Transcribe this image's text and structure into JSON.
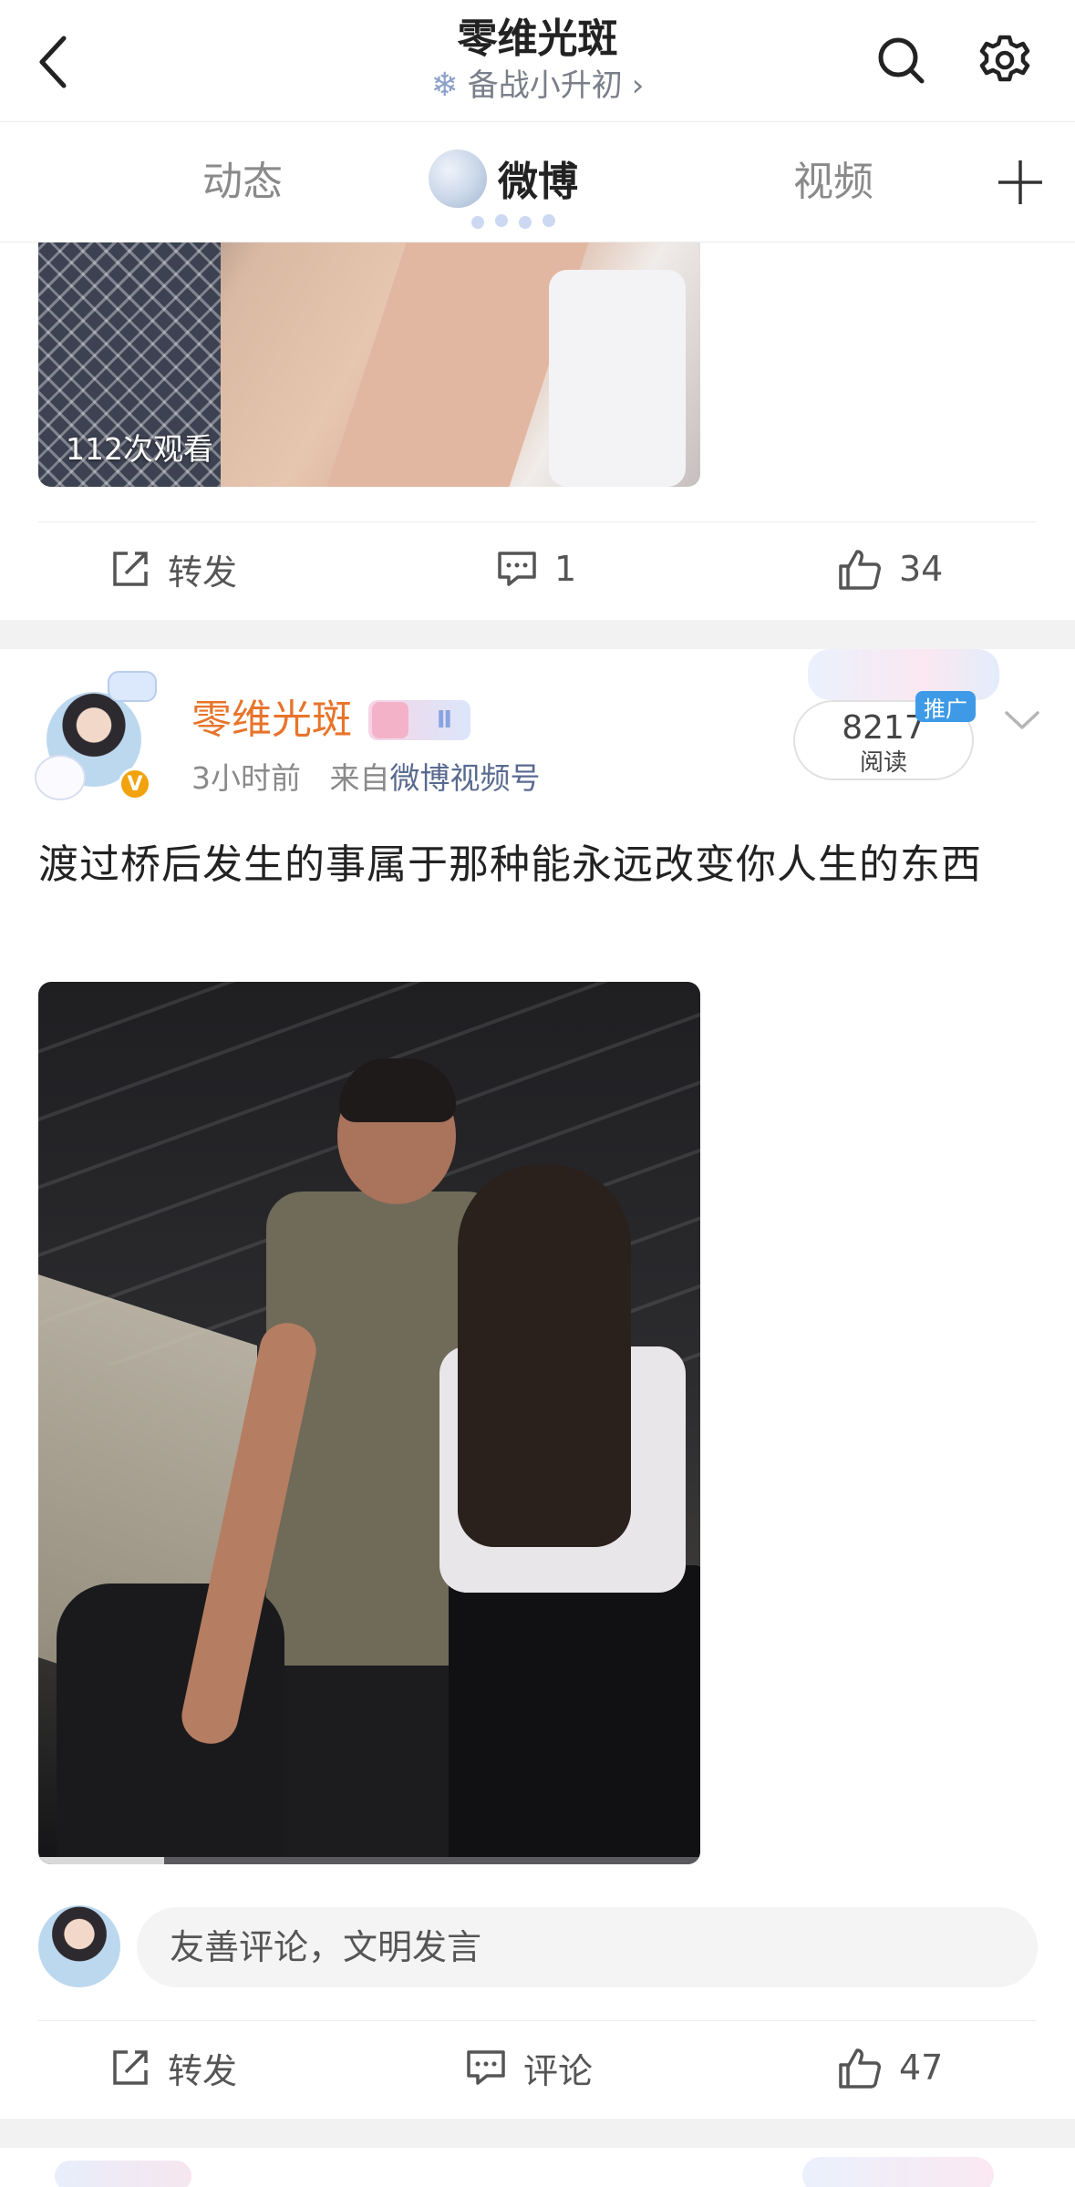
{
  "header": {
    "title": "零维光斑",
    "subtitle": "备战小升初",
    "subtitle_chevron": "›",
    "icons": [
      "back-icon",
      "search-icon",
      "gear-icon"
    ]
  },
  "tabs": {
    "items": [
      {
        "label": "动态",
        "active": false
      },
      {
        "label": "微博",
        "active": true
      },
      {
        "label": "视频",
        "active": false
      }
    ],
    "add_icon": "plus-icon"
  },
  "post1": {
    "view_count": "112次观看",
    "actions": {
      "repost_label": "转发",
      "comment_count": "1",
      "like_count": "34"
    }
  },
  "post2": {
    "username": "零维光斑",
    "badge_text": "Ⅱ",
    "verified_badge": "V",
    "time": "3小时前",
    "source_prefix": "来自",
    "source": "微博视频号",
    "promo": {
      "count": "8217",
      "label": "阅读",
      "tag": "推广"
    },
    "text": "渡过桥后发生的事属于那种能永远改变你人生的东西",
    "video_progress": 0.19,
    "comment_placeholder": "友善评论，文明发言",
    "actions": {
      "repost_label": "转发",
      "comment_label": "评论",
      "like_count": "47"
    }
  },
  "colors": {
    "username": "#e8742b",
    "source_link": "#596a8f",
    "promo_tag": "#3e9ae6",
    "verified": "#f2a20c"
  }
}
